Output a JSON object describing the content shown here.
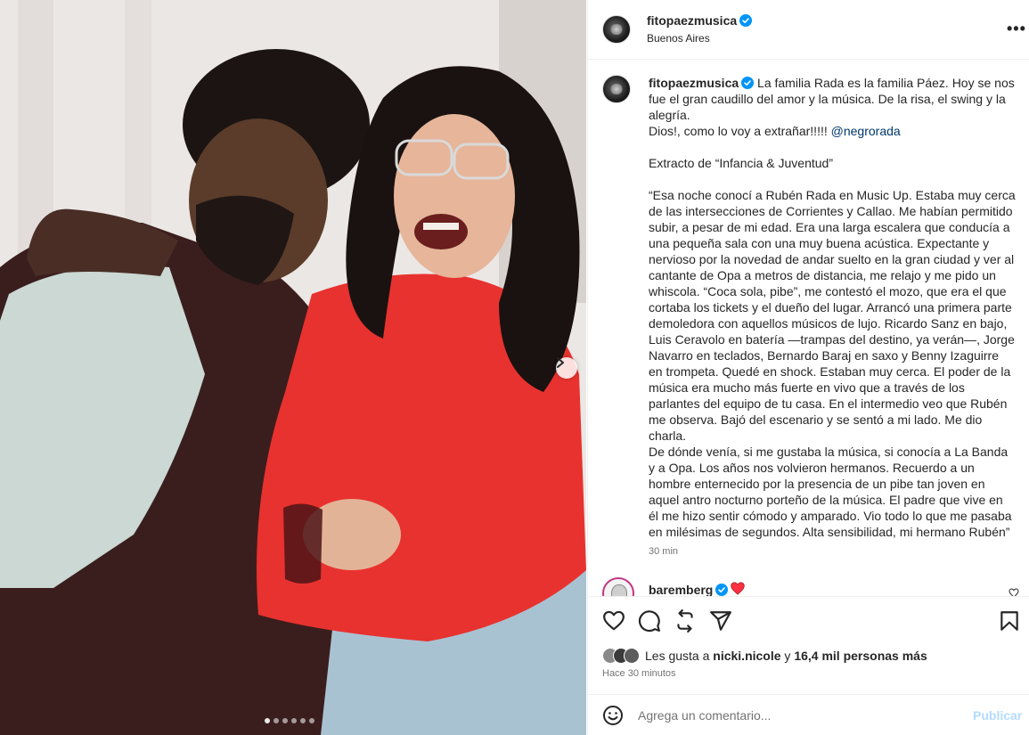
{
  "post": {
    "username": "fitopaezmusica",
    "location": "Buenos Aires",
    "more_label": "•••"
  },
  "caption": {
    "username": "fitopaezmusica",
    "text_before_mention": "La familia Rada es la familia Páez. Hoy se nos fue el gran caudillo del amor y la música. De la risa, el swing y la alegría.\nDios!, como lo voy a extrañar!!!!! ",
    "mention": "@negrorada",
    "text_after_mention": "\n\nExtracto de “Infancia & Juventud”\n\n“Esa noche conocí a Rubén Rada en Music Up. Estaba muy cerca de las intersecciones de Corrientes y Callao. Me habían permitido subir, a pesar de mi edad. Era una larga escalera que conducía a una pequeña sala con una muy buena acústica. Expectante y nervioso por la novedad de andar suelto en la gran ciudad y ver al cantante de Opa a metros de distancia, me relajo y me pido un whiscola. “Coca sola, pibe”, me contestó el mozo, que era el que cortaba los tickets y el dueño del lugar. Arrancó una primera parte demoledora con aquellos músicos de lujo. Ricardo Sanz en bajo, Luis Ceravolo en batería —trampas del destino, ya verán—, Jorge Navarro en teclados, Bernardo Baraj en saxo y Benny Izaguirre en trompeta. Quedé en shock. Estaban muy cerca. El poder de la música era mucho más fuerte en vivo que a través de los parlantes del equipo de tu casa. En el intermedio veo que Rubén me observa. Bajó del escenario y se sentó a mi lado. Me dio charla.\nDe dónde venía, si me gustaba la música, si conocía a La Banda y a Opa. Los años nos volvieron hermanos. Recuerdo a un hombre enternecido por la presencia de un pibe tan joven en aquel antro nocturno porteño de la música. El padre que vive en él me hizo sentir cómodo y amparado. Vio todo lo que me pasaba en milésimas de segundos. Alta sensibilidad, mi hermano Rubén”",
    "time": "30 min"
  },
  "first_comment": {
    "username": "baremberg"
  },
  "likes": {
    "prefix": "Les gusta a",
    "user": "nicki.nicole",
    "connector": "y",
    "others": "16,4 mil personas más"
  },
  "ago": "Hace 30 minutos",
  "comment_box": {
    "placeholder": "Agrega un comentario...",
    "publish_label": "Publicar"
  },
  "carousel": {
    "slide_count": 6,
    "active_index": 0
  },
  "colors": {
    "verified": "#0095f6",
    "heart": "#ff3040",
    "publish_disabled": "#b3dbff",
    "mention": "#00376b"
  },
  "icons": [
    "verified-badge-icon",
    "more-options-icon",
    "chevron-right-icon",
    "heart-icon",
    "comment-icon",
    "share-icon",
    "send-icon",
    "bookmark-icon",
    "emoji-icon"
  ]
}
